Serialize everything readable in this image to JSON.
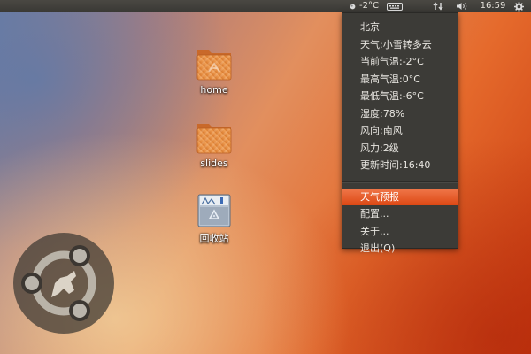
{
  "panel": {
    "temperature": "-2°C",
    "clock": "16:59",
    "icons": [
      "weather-icon",
      "keyboard-icon",
      "network-icon",
      "volume-icon",
      "settings-gear-icon"
    ]
  },
  "desktop": {
    "icons": [
      {
        "label": "home",
        "icon": "folder-icon"
      },
      {
        "label": "slides",
        "icon": "folder-icon"
      },
      {
        "label": "回收站",
        "icon": "trash-icon"
      }
    ]
  },
  "weather_menu": {
    "info": [
      "北京",
      "天气:小雪转多云",
      "当前气温:-2°C",
      "最高气温:0°C",
      "最低气温:-6°C",
      "湿度:78%",
      "风向:南风",
      "风力:2级",
      "更新时间:16:40"
    ],
    "actions": [
      "天气预报",
      "配置...",
      "关于...",
      "退出(Q)"
    ],
    "highlighted_action": "天气预报"
  },
  "colors": {
    "panel": "#3c3b37",
    "menu_bg": "#3c3b37",
    "highlight": "#dd4814",
    "folder": "#e08a3c"
  }
}
